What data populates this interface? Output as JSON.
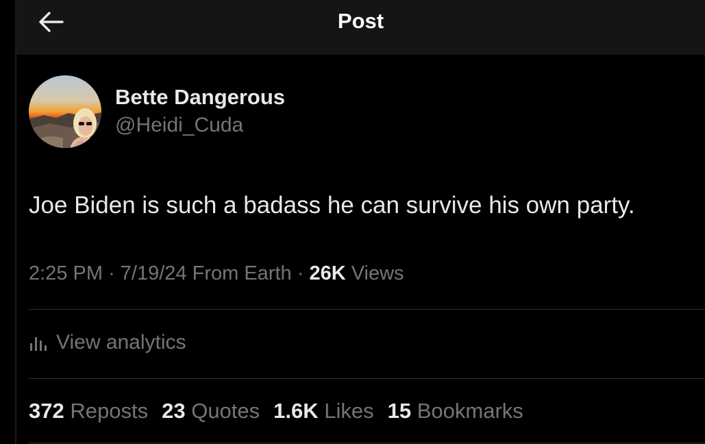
{
  "header": {
    "title": "Post",
    "back_icon": "arrow-left-icon"
  },
  "author": {
    "display_name": "Bette Dangerous",
    "handle": "@Heidi_Cuda"
  },
  "tweet": {
    "text": "Joe Biden is such a badass he can survive his own party.",
    "time": "2:25 PM",
    "separator": "·",
    "date": "7/19/24",
    "source": "From Earth",
    "views_count": "26K",
    "views_label": "Views"
  },
  "analytics": {
    "label": "View analytics",
    "icon": "bar-chart-icon"
  },
  "stats": [
    {
      "count": "372",
      "label": "Reposts"
    },
    {
      "count": "23",
      "label": "Quotes"
    },
    {
      "count": "1.6K",
      "label": "Likes"
    },
    {
      "count": "15",
      "label": "Bookmarks"
    }
  ],
  "colors": {
    "background": "#000000",
    "header_bg": "#151515",
    "primary_text": "#e7e9ea",
    "secondary_text": "#71767b",
    "divider": "#2f3336"
  }
}
